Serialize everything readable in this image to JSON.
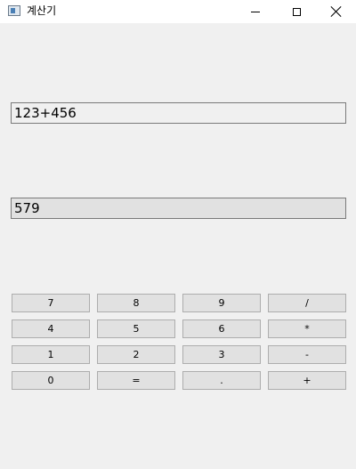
{
  "window": {
    "title": "계산기",
    "controls": {
      "minimize": "minimize-icon",
      "maximize": "maximize-icon",
      "close": "close-icon"
    }
  },
  "display": {
    "expression": "123+456",
    "result": "579"
  },
  "keypad": {
    "rows": [
      [
        "7",
        "8",
        "9",
        "/"
      ],
      [
        "4",
        "5",
        "6",
        "*"
      ],
      [
        "1",
        "2",
        "3",
        "-"
      ],
      [
        "0",
        "=",
        ".",
        "+"
      ]
    ]
  },
  "colors": {
    "window_background": "#f0f0f0",
    "titlebar_background": "#ffffff",
    "button_face": "#e1e1e1",
    "button_border": "#adadad",
    "field_border": "#7a7a7a"
  }
}
